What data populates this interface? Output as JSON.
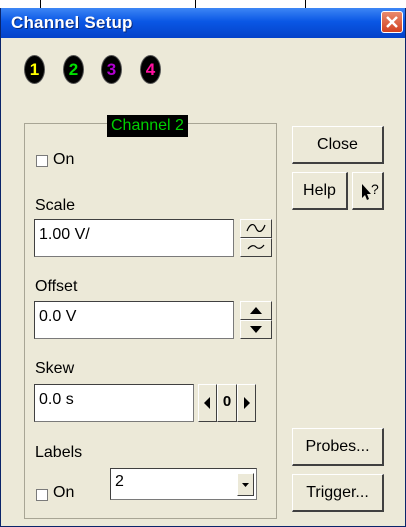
{
  "window": {
    "title": "Channel Setup"
  },
  "channels": [
    {
      "label": "1",
      "color": "#ffff00"
    },
    {
      "label": "2",
      "color": "#00e000"
    },
    {
      "label": "3",
      "color": "#b000d0"
    },
    {
      "label": "4",
      "color": "#ff10a0"
    }
  ],
  "group": {
    "caption": "Channel 2"
  },
  "on_toggle": {
    "label": "On",
    "checked": false
  },
  "scale": {
    "label": "Scale",
    "value": "1.00 V/"
  },
  "offset": {
    "label": "Offset",
    "value": "0.0 V"
  },
  "skew": {
    "label": "Skew",
    "value": "0.0 s",
    "zero_label": "0"
  },
  "labels": {
    "label": "Labels",
    "on_label": "On",
    "checked": false,
    "selected": "2"
  },
  "buttons": {
    "close": "Close",
    "help": "Help",
    "whats_this": "?",
    "probes": "Probes...",
    "trigger": "Trigger..."
  }
}
